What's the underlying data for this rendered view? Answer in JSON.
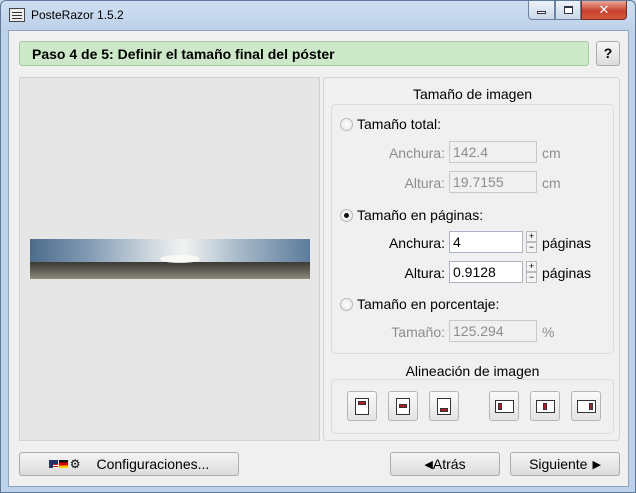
{
  "window": {
    "title": "PosteRazor 1.5.2",
    "icons": {
      "app": "posterazor-app-icon",
      "minimize": "minimize-icon",
      "maximize": "maximize-icon",
      "close": "close-icon",
      "close_glyph": "✕"
    }
  },
  "header": {
    "step_title": "Paso 4 de 5: Definir el tamaño final del póster",
    "help_label": "?"
  },
  "preview": {
    "image": "panorama-beach-image"
  },
  "image_size": {
    "group_title": "Tamaño de imagen",
    "total": {
      "label": "Tamaño total:",
      "selected": false,
      "width_label": "Anchura:",
      "width_value": "142.4",
      "width_unit": "cm",
      "height_label": "Altura:",
      "height_value": "19.7155",
      "height_unit": "cm"
    },
    "pages": {
      "label": "Tamaño en páginas:",
      "selected": true,
      "width_label": "Anchura:",
      "width_value": "4",
      "width_unit": "páginas",
      "height_label": "Altura:",
      "height_value": "0.9128",
      "height_unit": "páginas",
      "spin_up": "+",
      "spin_down": "−"
    },
    "percent": {
      "label": "Tamaño en porcentaje:",
      "selected": false,
      "size_label": "Tamaño:",
      "size_value": "125.294",
      "size_unit": "%"
    }
  },
  "image_alignment": {
    "group_title": "Alineación de imagen",
    "buttons": [
      "align-top-icon",
      "align-middle-icon",
      "align-bottom-icon",
      "align-left-icon",
      "align-center-icon",
      "align-right-icon"
    ]
  },
  "footer": {
    "settings_label": "Configuraciones...",
    "back_label": "Atrás",
    "next_label": "Siguiente",
    "back_arrow": "◀",
    "next_arrow": "▶",
    "settings_icons": [
      "us-flag-icon",
      "germany-flag-icon",
      "gear-icon"
    ],
    "gear_glyph": "⚙"
  },
  "colors": {
    "header_bg": "#cde8c9",
    "align_mark": "#b01d2a",
    "close_button": "#c7422c"
  }
}
